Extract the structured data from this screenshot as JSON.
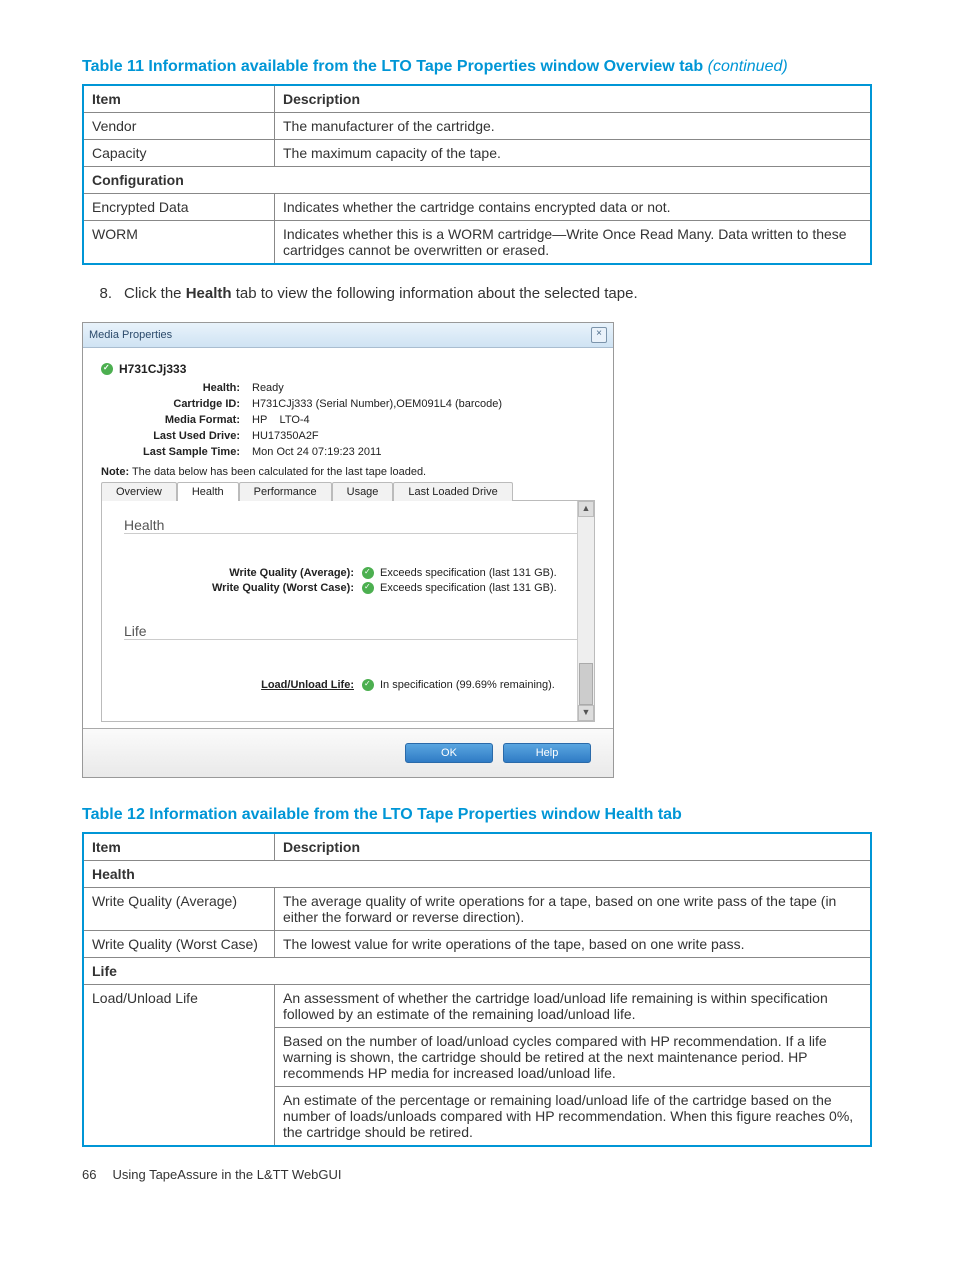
{
  "table11": {
    "title_prefix": "Table 11 Information available from the LTO Tape Properties window Overview tab ",
    "continued": "(continued)",
    "headers": [
      "Item",
      "Description"
    ],
    "rows": [
      {
        "item": "Vendor",
        "desc": "The manufacturer of the cartridge."
      },
      {
        "item": "Capacity",
        "desc": "The maximum capacity of the tape."
      }
    ],
    "section2_header": "Configuration",
    "rows2": [
      {
        "item": "Encrypted Data",
        "desc": "Indicates whether the cartridge contains encrypted data or not."
      },
      {
        "item": "WORM",
        "desc": "Indicates whether this is a WORM cartridge—Write Once Read Many. Data written to these cartridges cannot be overwritten or erased."
      }
    ]
  },
  "step": {
    "num": "8.",
    "prefix": "Click the ",
    "bold": "Health",
    "suffix": " tab to view the following information about the selected tape."
  },
  "media": {
    "window_title": "Media Properties",
    "heading": "H731CJj333",
    "fields": {
      "health_label": "Health:",
      "health_value": "Ready",
      "cartridge_label": "Cartridge ID:",
      "cartridge_value": "H731CJj333 (Serial Number),OEM091L4 (barcode)",
      "format_label": "Media Format:",
      "format_value1": "HP",
      "format_value2": "LTO-4",
      "drive_label": "Last Used Drive:",
      "drive_value": "HU17350A2F",
      "sample_label": "Last Sample Time:",
      "sample_value": "Mon Oct 24 07:19:23 2011"
    },
    "note_label": "Note:",
    "note_text": " The data below has been calculated for the last tape loaded.",
    "tabs": [
      "Overview",
      "Health",
      "Performance",
      "Usage",
      "Last Loaded Drive"
    ],
    "section_health": "Health",
    "wq_avg_label": "Write Quality (Average):",
    "wq_avg_value": "Exceeds specification (last 131 GB).",
    "wq_worst_label": "Write Quality (Worst Case):",
    "wq_worst_value": "Exceeds specification (last 131 GB).",
    "section_life": "Life",
    "load_label": "Load/Unload Life:",
    "load_value": "In specification (99.69% remaining).",
    "btn_ok": "OK",
    "btn_help": "Help"
  },
  "table12": {
    "title": "Table 12 Information available from the LTO Tape Properties window Health tab",
    "headers": [
      "Item",
      "Description"
    ],
    "section_health": "Health",
    "rows_health": [
      {
        "item": "Write Quality (Average)",
        "desc": "The average quality of write operations for a tape, based on one write pass of the tape (in either the forward or reverse direction)."
      },
      {
        "item": "Write Quality (Worst Case)",
        "desc": "The lowest value for write operations of the tape, based on one write pass."
      }
    ],
    "section_life": "Life",
    "life_item": "Load/Unload Life",
    "life_desc1": "An assessment of whether the cartridge load/unload life remaining is within specification followed by an estimate of the remaining load/unload life.",
    "life_desc2": "Based on the number of load/unload cycles compared with HP recommendation. If a life warning is shown, the cartridge should be retired at the next maintenance period. HP recommends HP media for increased load/unload life.",
    "life_desc3": "An estimate of the percentage or remaining load/unload life of the cartridge based on the number of loads/unloads compared with HP recommendation. When this figure reaches 0%, the cartridge should be retired."
  },
  "footer": {
    "page_num": "66",
    "page_title": "Using TapeAssure in the L&TT WebGUI"
  }
}
